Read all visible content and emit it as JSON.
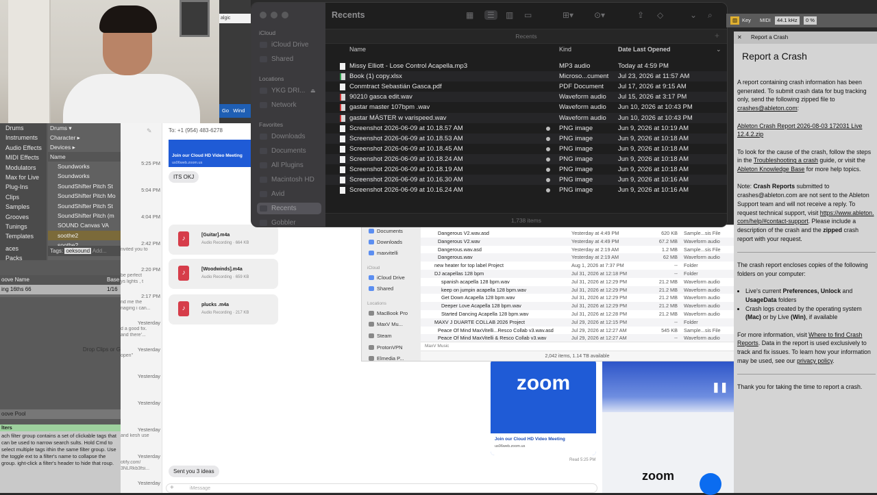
{
  "finder": {
    "title": "Recents",
    "tab_label": "Recents",
    "status": "1,738 items",
    "sidebar": {
      "sections": [
        "iCloud",
        "Locations",
        "Favorites"
      ],
      "icloud": [
        "iCloud Drive",
        "Shared"
      ],
      "locations": [
        "YKG DRI...",
        "Network"
      ],
      "favorites": [
        "Downloads",
        "Documents",
        "All Plugins",
        "Macintosh HD",
        "Avid",
        "Recents",
        "Gobbler"
      ]
    },
    "columns": {
      "name": "Name",
      "kind": "Kind",
      "date": "Date Last Opened"
    },
    "rows": [
      {
        "name": "Missy Elliott - Lose Control Acapella.mp3",
        "kind": "MP3 audio",
        "date": "Today at 4:59 PM"
      },
      {
        "name": "Book (1) copy.xlsx",
        "kind": "Microso...cument",
        "date": "Jul 23, 2026 at 11:57 AM"
      },
      {
        "name": "Conmtract Sebastián  Gasca.pdf",
        "kind": "PDF Document",
        "date": "Jul 17, 2026 at 9:15 AM"
      },
      {
        "name": "90210 gasca edit.wav",
        "kind": "Waveform audio",
        "date": "Jul 15, 2026 at 3:17 PM"
      },
      {
        "name": "gastar  master 107bpm .wav",
        "kind": "Waveform audio",
        "date": "Jun 10, 2026 at 10:43 PM"
      },
      {
        "name": "gastar  MÁSTER w varispeed.wav",
        "kind": "Waveform audio",
        "date": "Jun 10, 2026 at 10:43 PM"
      },
      {
        "name": "Screenshot 2026-06-09 at 10.18.57 AM",
        "kind": "PNG image",
        "date": "Jun 9, 2026 at 10:19 AM"
      },
      {
        "name": "Screenshot 2026-06-09 at 10.18.53 AM",
        "kind": "PNG image",
        "date": "Jun 9, 2026 at 10:18 AM"
      },
      {
        "name": "Screenshot 2026-06-09 at 10.18.45 AM",
        "kind": "PNG image",
        "date": "Jun 9, 2026 at 10:18 AM"
      },
      {
        "name": "Screenshot 2026-06-09 at 10.18.24 AM",
        "kind": "PNG image",
        "date": "Jun 9, 2026 at 10:18 AM"
      },
      {
        "name": "Screenshot 2026-06-09 at 10.18.19 AM",
        "kind": "PNG image",
        "date": "Jun 9, 2026 at 10:18 AM"
      },
      {
        "name": "Screenshot 2026-06-09 at 10.16.30 AM",
        "kind": "PNG image",
        "date": "Jun 9, 2026 at 10:16 AM"
      },
      {
        "name": "Screenshot 2026-06-09 at 10.16.24 AM",
        "kind": "PNG image",
        "date": "Jun 9, 2026 at 10:16 AM"
      }
    ]
  },
  "finder2": {
    "sidebar": [
      "Documents",
      "Downloads",
      "maxvitelli"
    ],
    "icloud_label": "iCloud",
    "icloud": [
      "iCloud Drive",
      "Shared"
    ],
    "locations_label": "Locations",
    "locations": [
      "MacBook Pro",
      "MaxV Mu...",
      "Steam",
      "ProtonVPN",
      "Elmedia P..."
    ],
    "rows": [
      {
        "name": "Dangerous V2.wav.asd",
        "date": "Yesterday at 4:49 PM",
        "size": "620 KB",
        "kind": "Sample...sis File"
      },
      {
        "name": "Dangerous V2.wav",
        "date": "Yesterday at 4:49 PM",
        "size": "67.2 MB",
        "kind": "Waveform audio"
      },
      {
        "name": "Dangerous.wav.asd",
        "date": "Yesterday at 2:19 AM",
        "size": "1.2 MB",
        "kind": "Sample...sis File"
      },
      {
        "name": "Dangerous.wav",
        "date": "Yesterday at 2:19 AM",
        "size": "62 MB",
        "kind": "Waveform audio"
      },
      {
        "name": "new heater for top label Project",
        "date": "Aug 1, 2026 at 7:37 PM",
        "size": "--",
        "kind": "Folder"
      },
      {
        "name": "DJ acapellas 128 bpm",
        "date": "Jul 31, 2026 at 12:18 PM",
        "size": "--",
        "kind": "Folder"
      },
      {
        "name": "spanish acapella 128 bpm.wav",
        "date": "Jul 31, 2026 at 12:29 PM",
        "size": "21.2 MB",
        "kind": "Waveform audio"
      },
      {
        "name": "keep on jumpin acapella 128 bpm.wav",
        "date": "Jul 31, 2026 at 12:29 PM",
        "size": "21.2 MB",
        "kind": "Waveform audio"
      },
      {
        "name": "Get Down Acapella 128 bpm.wav",
        "date": "Jul 31, 2026 at 12:29 PM",
        "size": "21.2 MB",
        "kind": "Waveform audio"
      },
      {
        "name": "Deeper Love Acapella 128 bpm.wav",
        "date": "Jul 31, 2026 at 12:29 PM",
        "size": "21.2 MB",
        "kind": "Waveform audio"
      },
      {
        "name": "Started Dancing Acapella 128 bpm.wav",
        "date": "Jul 31, 2026 at 12:28 PM",
        "size": "21.2 MB",
        "kind": "Waveform audio"
      },
      {
        "name": "MAXV J DUARTE COLLAB 2026 Project",
        "date": "Jul 29, 2026 at 12:15 PM",
        "size": "--",
        "kind": "Folder"
      },
      {
        "name": "Peace Of Mind MaxVitelli...Resco Collab v3.wav.asd",
        "date": "Jul 29, 2026 at 12:27 AM",
        "size": "545 KB",
        "kind": "Sample...sis File"
      },
      {
        "name": "Peace Of Mind MaxVitelli & Resco Collab v3.wav",
        "date": "Jul 29, 2026 at 12:27 AM",
        "size": "--",
        "kind": "Waveform audio"
      }
    ],
    "path": "MaxV Music",
    "status": "2,042 items, 1.14 TB available"
  },
  "ableton": {
    "categories": [
      "Drums",
      "Instruments",
      "Audio Effects",
      "MIDI Effects",
      "Modulators",
      "Max for Live",
      "Plug-Ins",
      "Clips",
      "Samples",
      "Grooves",
      "Tunings",
      "Templates"
    ],
    "extra_left": [
      "aces",
      "Packs"
    ],
    "filters": [
      "Drums ▾",
      "Character ▸",
      "Devices ▸"
    ],
    "name_header": "Name",
    "items": [
      "Soundworks",
      "Soundworks",
      "SoundShifter Pitch St",
      "SoundShifter Pitch Mo",
      "SoundShifter Pitch St",
      "SoundShifter Pitch (m",
      "SOUND Canvas VA",
      "soothe2",
      "soothe2"
    ],
    "tags_label": "Tags:",
    "tag": "oeksound",
    "tag_add": "Add...",
    "groove_header_name": "oove Name",
    "groove_header_base": "Base",
    "groove_row": "ing 16ths 66",
    "groove_base": "1/16",
    "drop_text": "Drop Clips or G",
    "groove_pool": "oove Pool",
    "filters_title": "lters",
    "help_text": "ach filter group contains a set of clickable tags that can be used to narrow search sults. Hold Cmd to select multiple tags ithin the same filter group. Use the toggle ext to a filter's name to collapse the group. ight-click a filter's header to hide that roup.",
    "top_strip": "algic",
    "go_label": "Go",
    "win_label": "Wind",
    "key_label": "Key",
    "midi_label": "MIDI",
    "sample_rate": "44.1 kHz",
    "cpu": "0 %",
    "crash": {
      "tab": "Report a Crash",
      "title": "Report a Crash",
      "p1": "A report containing crash information has been generated. To submit crash data for bug tracking only, send the following zipped file to",
      "email": "crashes@ableton.com",
      "file": "Ableton Crash Report 2026-08-03 172031 Live 12.4.2.zip",
      "p2a": "To look for the cause of the crash, follow the steps in the",
      "p2link": "Troubleshooting a crash",
      "p2b": "guide, or visit the",
      "p2link2": "Ableton Knowledge Base",
      "p2c": "for more help topics.",
      "p3a": "Note:",
      "p3b": "Crash Reports",
      "p3c": "submitted to crashes@ableton.com are not sent to the Ableton Support team and will not receive a reply. To request technical support, visit",
      "p3link": "https://www.ableton.com/help/#contact-support",
      "p3d": ". Please include a description of the crash and the",
      "p3e": "zipped",
      "p3f": "crash report with your request.",
      "p4": "The crash report encloses copies of the following folders on your computer:",
      "b1a": "Live's current",
      "b1b": "Preferences, Unlock",
      "b1c": "and",
      "b1d": "UsageData",
      "b1e": "folders",
      "b2a": "Crash logs created by the operating system",
      "b2b": "(Mac)",
      "b2c": "or by Live",
      "b2d": "(Win)",
      "b2e": ", if available",
      "p5a": "For more information, visit",
      "p5link": "Where to find Crash Reports",
      "p5b": ". Data in the report is used exclusively to track and fix issues. To learn how your information may be used, see our",
      "p5link2": "privacy policy",
      "p6": "Thank you for taking the time to report a crash."
    }
  },
  "messages": {
    "to": "To: +1 (954) 483-6278",
    "times": [
      "5:25 PM",
      "5:04 PM",
      "4:04 PM",
      "2:42 PM",
      "2:20 PM",
      "2:17 PM",
      "Yesterday",
      "Yesterday",
      "Yesterday",
      "Yesterday",
      "Yesterday",
      "Yesterday",
      "Yesterday",
      "Yesterday"
    ],
    "snippets": [
      "nvited you to",
      "be perfect",
      "ys lights , t",
      "nd me the",
      "naging i can...",
      "d a good fix.",
      "and there'...",
      "open\"",
      "and kesh use",
      "otify.com/",
      "3NLRkb3fsi..."
    ],
    "its_okj": "ITS OKJ",
    "sent_ideas": "Sent you 3 ideas",
    "zoom_card_title": "Join our Cloud HD Video Meeting",
    "zoom_card_url": "us06web.zoom.us",
    "zoom_logo": "zoom",
    "attachments": [
      {
        "name": "[Guitar].m4a",
        "sub": "Audio Recording · 664 KB"
      },
      {
        "name": "[Woodwinds].m4a",
        "sub": "Audio Recording · 659 KB"
      },
      {
        "name": "plucks .m4a",
        "sub": "Audio Recording · 217 KB"
      }
    ],
    "read_label": "Read 5:25 PM",
    "input_placeholder": "iMessage"
  }
}
